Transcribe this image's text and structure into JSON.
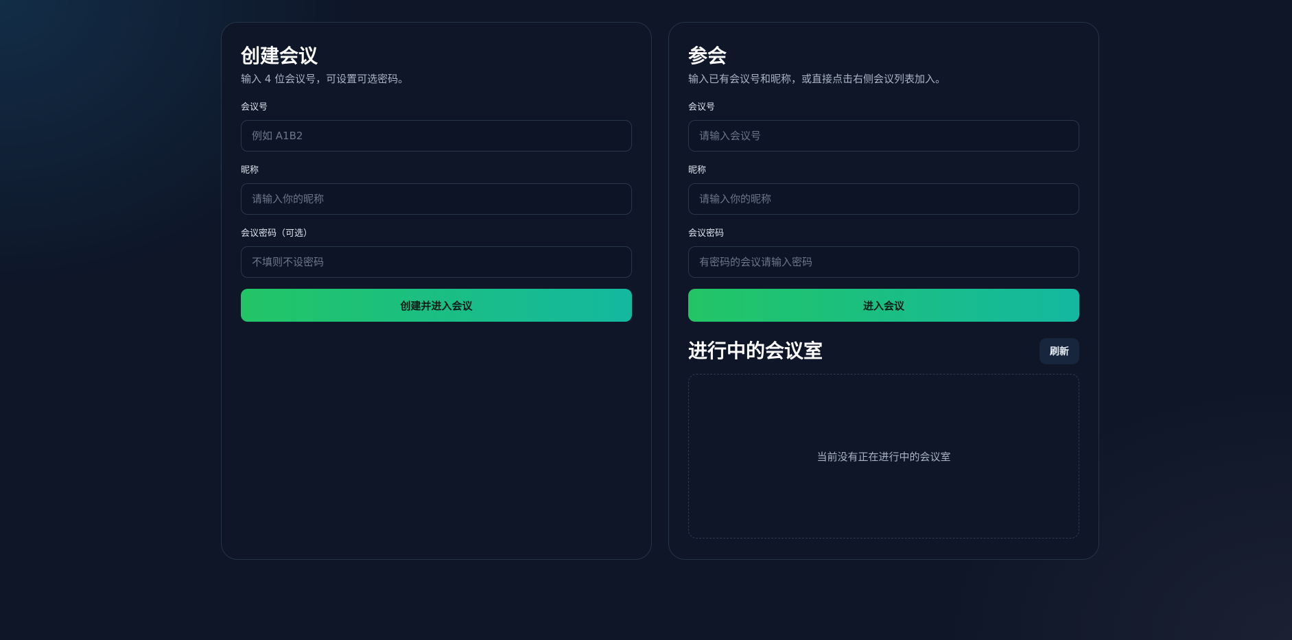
{
  "create": {
    "title": "创建会议",
    "subtitle": "输入 4 位会议号，可设置可选密码。",
    "room_label": "会议号",
    "room_placeholder": "例如 A1B2",
    "nickname_label": "昵称",
    "nickname_placeholder": "请输入你的昵称",
    "password_label": "会议密码（可选）",
    "password_placeholder": "不填则不设密码",
    "submit_label": "创建并进入会议"
  },
  "join": {
    "title": "参会",
    "subtitle": "输入已有会议号和昵称，或直接点击右侧会议列表加入。",
    "room_label": "会议号",
    "room_placeholder": "请输入会议号",
    "nickname_label": "昵称",
    "nickname_placeholder": "请输入你的昵称",
    "password_label": "会议密码",
    "password_placeholder": "有密码的会议请输入密码",
    "submit_label": "进入会议"
  },
  "rooms": {
    "title": "进行中的会议室",
    "refresh_label": "刷新",
    "empty_text": "当前没有正在进行中的会议室"
  },
  "colors": {
    "background": "#0e1628",
    "card_border": "#263447",
    "accent_start": "#22c565",
    "accent_end": "#14b8a0",
    "refresh_bg": "#17263c"
  }
}
